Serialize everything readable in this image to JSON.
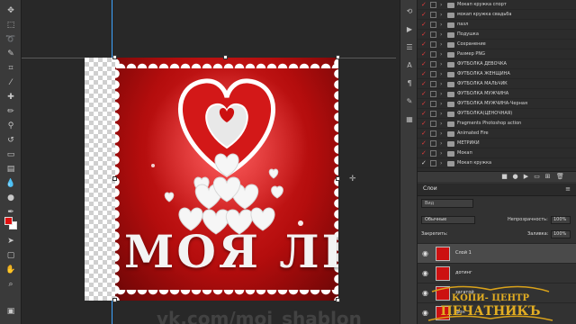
{
  "colors": {
    "foreground_swatch": "#e01010",
    "background_swatch": "#ffffff",
    "artwork_red": "#c41414",
    "check_red": "#e33c3c",
    "logo_gold": "#d9a21a"
  },
  "toolbar": {
    "tools": [
      "move-icon",
      "marquee-icon",
      "lasso-icon",
      "quick-select-icon",
      "crop-icon",
      "eyedropper-icon",
      "healing-icon",
      "brush-icon",
      "clone-stamp-icon",
      "history-brush-icon",
      "eraser-icon",
      "gradient-icon",
      "blur-icon",
      "dodge-icon",
      "pen-icon",
      "type-icon",
      "path-select-icon",
      "shape-icon",
      "hand-icon",
      "zoom-icon"
    ]
  },
  "artwork": {
    "text": "МОЯ ЛІ",
    "watermark": "vk.com/moi_shablon"
  },
  "actions_panel": {
    "items": [
      {
        "label": "Мокап кружка спорт",
        "checked": true
      },
      {
        "label": "мокап кружка свадьба",
        "checked": true
      },
      {
        "label": "пазл",
        "checked": true
      },
      {
        "label": "Подушка",
        "checked": true
      },
      {
        "label": "Сохранение",
        "checked": true
      },
      {
        "label": "Размер PNG",
        "checked": true
      },
      {
        "label": "ФУТБОЛКА ДЕВОЧКА",
        "checked": true
      },
      {
        "label": "ФУТБОЛКА ЖЕНЩИНА",
        "checked": true
      },
      {
        "label": "ФУТБОЛКА МАЛЬЧИК",
        "checked": true
      },
      {
        "label": "ФУТБОЛКА МУЖЧИНА",
        "checked": true
      },
      {
        "label": "ФУТБОЛКА МУЖЧИНА-Черная",
        "checked": true
      },
      {
        "label": "ФУТБОЛКА(ЦЕНОЧНАЯ)",
        "checked": true
      },
      {
        "label": "Fragments Photoshop action",
        "checked": true
      },
      {
        "label": "Animated Fire",
        "checked": true
      },
      {
        "label": "МЕТРИКИ",
        "checked": true
      },
      {
        "label": "Мокап",
        "checked": true
      },
      {
        "label": "Мокап кружка",
        "checked": false
      }
    ]
  },
  "layers_panel": {
    "tab_label": "Слои",
    "search_placeholder": "Вид",
    "blend_mode": "Обычные",
    "opacity_label": "Непрозрачность:",
    "opacity_value": "100%",
    "lock_label": "Закрепить:",
    "fill_label": "Заливка:",
    "fill_value": "100%",
    "layers": [
      {
        "name": "Слой 1",
        "selected": true
      },
      {
        "name": "дотинг",
        "selected": false
      },
      {
        "name": "загатой",
        "selected": false
      },
      {
        "name": "фон",
        "selected": false
      }
    ]
  },
  "logo": {
    "line1": "КОПИ- ЦЕНТР",
    "line2": "ПЕЧАТНИКЪ"
  }
}
